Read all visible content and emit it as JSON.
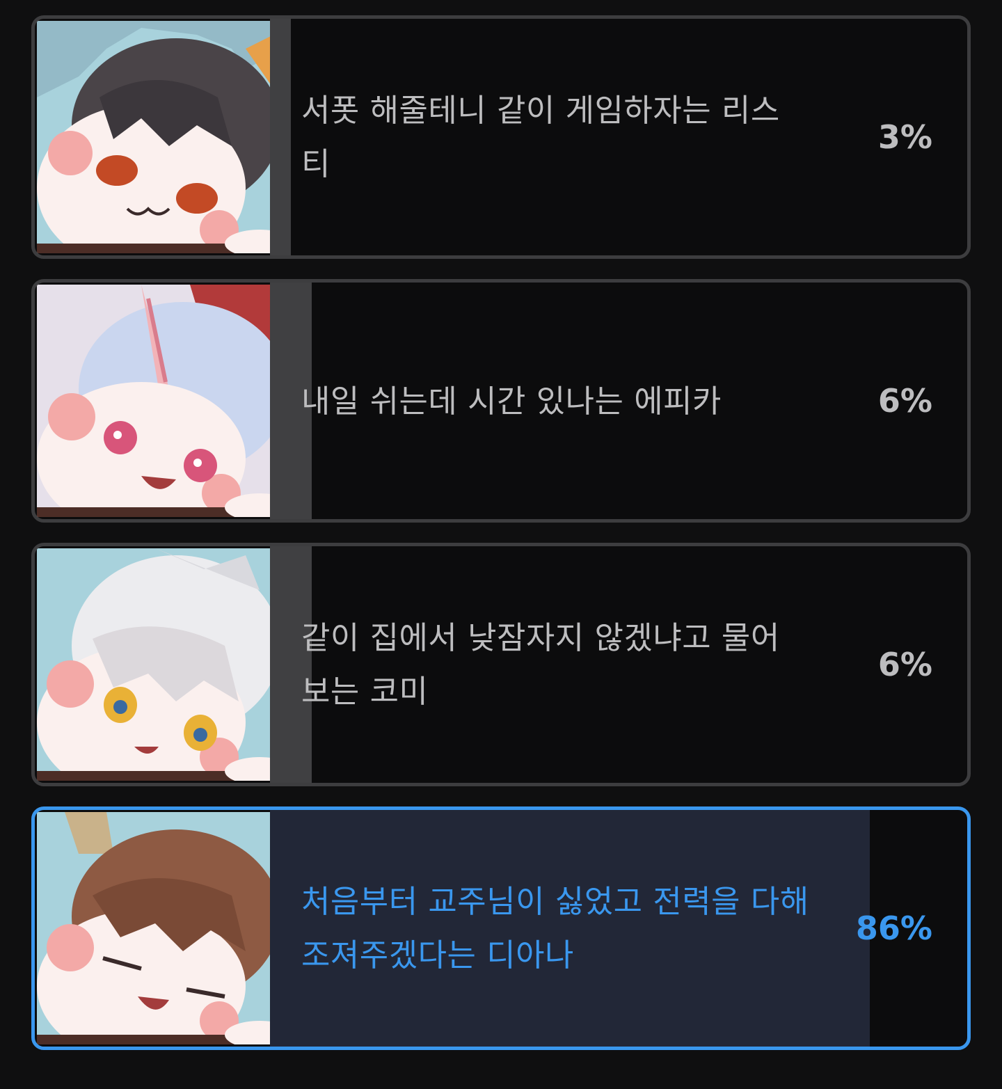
{
  "poll": {
    "options": [
      {
        "label": "서폿 해줄테니 같이 게임하자는 리스티",
        "percent_text": "3%",
        "percent": 3,
        "selected": false,
        "avatar_icon": "character-avatar-dark-hair"
      },
      {
        "label": "내일 쉬는데 시간 있나는 에피카",
        "percent_text": "6%",
        "percent": 6,
        "selected": false,
        "avatar_icon": "character-avatar-unicorn"
      },
      {
        "label": "같이 집에서 낮잠자지 않겠냐고 물어보는 코미",
        "percent_text": "6%",
        "percent": 6,
        "selected": false,
        "avatar_icon": "character-avatar-white-hair"
      },
      {
        "label": "처음부터 교주님이 싫었고 전력을 다해 조져주겠다는 디아나",
        "percent_text": "86%",
        "percent": 86,
        "selected": true,
        "avatar_icon": "character-avatar-brown-hair"
      }
    ]
  },
  "colors": {
    "background": "#0f0f10",
    "border": "#3d3d3f",
    "fill": "#404042",
    "text": "#bdbdbf",
    "selected_accent": "#3a97ee",
    "selected_fill": "#222737"
  }
}
